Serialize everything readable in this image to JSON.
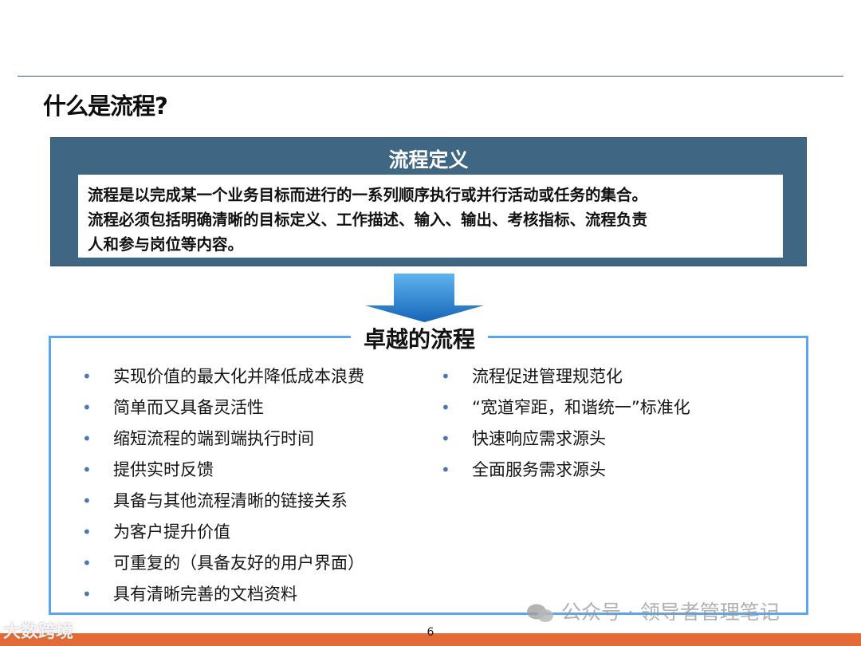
{
  "page_title": "什么是流程?",
  "definition": {
    "heading": "流程定义",
    "lines": [
      "流程是以完成某一个业务目标而进行的一系列顺序执行或并行活动或任务的集合。",
      "流程必须包括明确清晰的目标定义、工作描述、输入、输出、考核指标、流程负责",
      "人和参与岗位等内容。"
    ]
  },
  "excellent": {
    "heading": "卓越的流程",
    "left_items": [
      "实现价值的最大化并降低成本浪费",
      "简单而又具备灵活性",
      "缩短流程的端到端执行时间",
      "提供实时反馈",
      "具备与其他流程清晰的链接关系",
      "为客户提升价值",
      "可重复的（具备友好的用户界面）",
      "具有清晰完善的文档资料"
    ],
    "right_items": [
      "流程促进管理规范化",
      "“宽道窄距，和谐统一”标准化",
      "快速响应需求源头",
      "全面服务需求源头"
    ],
    "bullet_glyph": "•"
  },
  "footer": {
    "page_number": "6",
    "watermark_left": "大数跨境",
    "watermark_right": "公众号 · 领导者管理笔记"
  },
  "colors": {
    "definition_panel": "#3f6784",
    "frame_border": "#5aa7f0",
    "arrow": "#1e78c8",
    "footer_bar": "#e26b37"
  },
  "icons": {
    "arrow": "down-arrow-icon",
    "wechat": "wechat-icon"
  }
}
